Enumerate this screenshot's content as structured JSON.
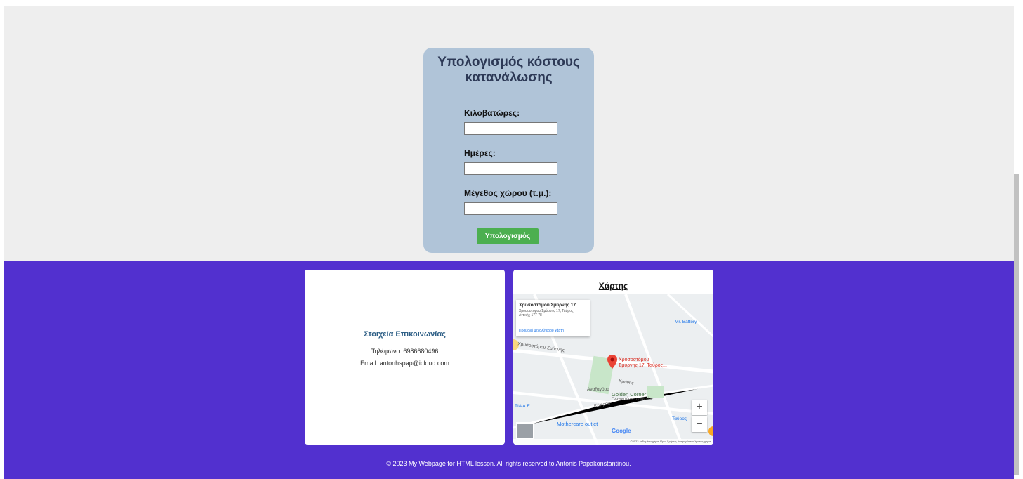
{
  "calculator": {
    "title": "Υπολογισμός κόστους κατανάλωσης",
    "fields": [
      {
        "label": "Κιλοβατώρες:",
        "value": ""
      },
      {
        "label": "Ημέρες:",
        "value": ""
      },
      {
        "label": "Μέγεθος χώρου (τ.μ.):",
        "value": ""
      }
    ],
    "button_label": "Υπολογισμός",
    "colors": {
      "card": "#b0c4d8",
      "button": "#4caf50",
      "title": "#2d3956"
    }
  },
  "contact": {
    "title": "Στοιχεία Επικοινωνίας",
    "phone": "Τηλέφωνο: 6986680496",
    "email": "Email: antonhspap@icloud.com"
  },
  "map": {
    "title": "Χάρτης",
    "info_title": "Χρυσοστόμου Σμύρνης 17",
    "info_address_line1": "Χρυσοστόμου Σμύρνης 17, Ταύρος",
    "info_address_line2": "Αττικής 177 78",
    "info_link": "Προβολή μεγαλύτερου χάρτη",
    "pin_label_line1": "Χρυσοστόμου",
    "pin_label_line2": "Σμύρνης 17, Ταύρος...",
    "places": {
      "battery": "Mr. Battery",
      "golden": "Golden Corner",
      "gym": "Γυμναστήριο πυγμαχίας",
      "mothercare": "Mothercare outlet",
      "tavros": "Ταύρος",
      "street1": "Χρυσοστόμου Σμύρνης",
      "street2": "Κρήνης",
      "street3": "Αναξαγόρα",
      "street4": "Κύπρου",
      "street5": "Ατιας",
      "ae": "ΤΙΑ Α.Ε."
    },
    "zoom_in": "+",
    "zoom_out": "−",
    "google": "Google",
    "footer_text": "©2023 Δεδομένα χάρτη   Όροι Χρήσης   Αναφορά σφάλματος χάρτη"
  },
  "footer": {
    "copyright": "© 2023 My Webpage for HTML lesson. All rights reserved to Antonis Papakonstantinou.",
    "color": "#5230cf"
  }
}
